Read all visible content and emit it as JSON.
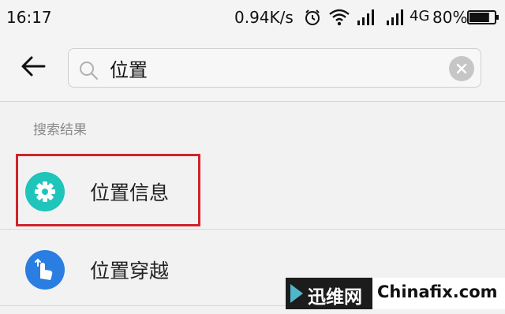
{
  "status_bar": {
    "time": "16:17",
    "network_speed": "0.94K/s",
    "network_type": "4G",
    "battery_percent": "80%",
    "battery_level": 0.8,
    "icons": [
      "alarm-icon",
      "wifi-icon",
      "signal-icon",
      "signal-icon",
      "battery-icon"
    ]
  },
  "search": {
    "back_icon": "back-arrow-icon",
    "value": "位置",
    "search_icon": "search-icon",
    "clear_icon": "clear-icon"
  },
  "results": {
    "section_label": "搜索结果",
    "items": [
      {
        "label": "位置信息",
        "icon": "gear-icon",
        "icon_color": "#1fc4bb",
        "highlighted": true
      },
      {
        "label": "位置穿越",
        "icon": "touch-hand-icon",
        "icon_color": "#2a7de1",
        "highlighted": false
      }
    ]
  },
  "watermark": {
    "left_text": "迅维网",
    "right_text": "Chinafix.com"
  },
  "colors": {
    "highlight_border": "#d0242b",
    "background": "#f2f2f2"
  }
}
